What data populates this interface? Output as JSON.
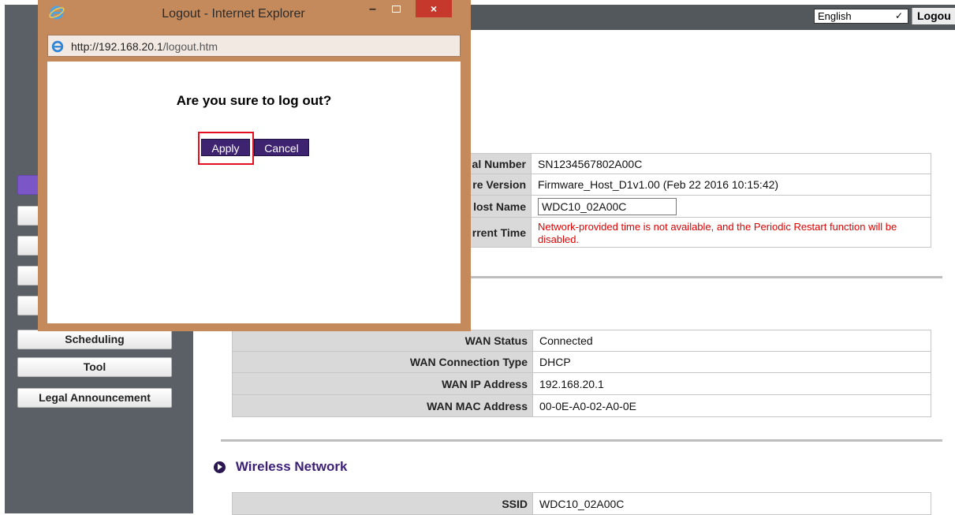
{
  "topbar": {
    "language_value": "English",
    "logout_label": "Logou"
  },
  "sidebar": {
    "items": [
      {
        "label": ""
      },
      {
        "label": ""
      },
      {
        "label": ""
      },
      {
        "label": ""
      },
      {
        "label": ""
      },
      {
        "label": "Scheduling"
      },
      {
        "label": "Tool"
      },
      {
        "label": "Legal Announcement"
      }
    ]
  },
  "system": {
    "rows": [
      {
        "label": "al Number",
        "value": "SN1234567802A00C"
      },
      {
        "label": "re Version",
        "value": "Firmware_Host_D1v1.00 (Feb 22 2016 10:15:42)"
      },
      {
        "label": "lost Name",
        "value": "WDC10_02A00C"
      },
      {
        "label": "rrent Time",
        "value": "Network-provided time is not available, and the Periodic Restart function will be disabled."
      }
    ]
  },
  "wan": {
    "rows": [
      {
        "label": "WAN Status",
        "value": "Connected"
      },
      {
        "label": "WAN Connection Type",
        "value": "DHCP"
      },
      {
        "label": "WAN IP Address",
        "value": "192.168.20.1"
      },
      {
        "label": "WAN MAC Address",
        "value": "00-0E-A0-02-A0-0E"
      }
    ]
  },
  "wireless": {
    "title": "Wireless Network",
    "rows": [
      {
        "label": "SSID",
        "value": "WDC10_02A00C"
      }
    ]
  },
  "popup": {
    "title": "Logout - Internet Explorer",
    "url_host": "http://192.168.20.1",
    "url_path": "/logout.htm",
    "question": "Are you sure to log out?",
    "apply_label": "Apply",
    "cancel_label": "Cancel",
    "close_glyph": "×",
    "min_glyph": "–"
  },
  "colors": {
    "sidebar": "#5b6066",
    "window_frame": "#c48a5c",
    "button": "#3e2470",
    "highlight": "#e3101d",
    "accent_text": "#3d1f78",
    "warning": "#e00000"
  }
}
